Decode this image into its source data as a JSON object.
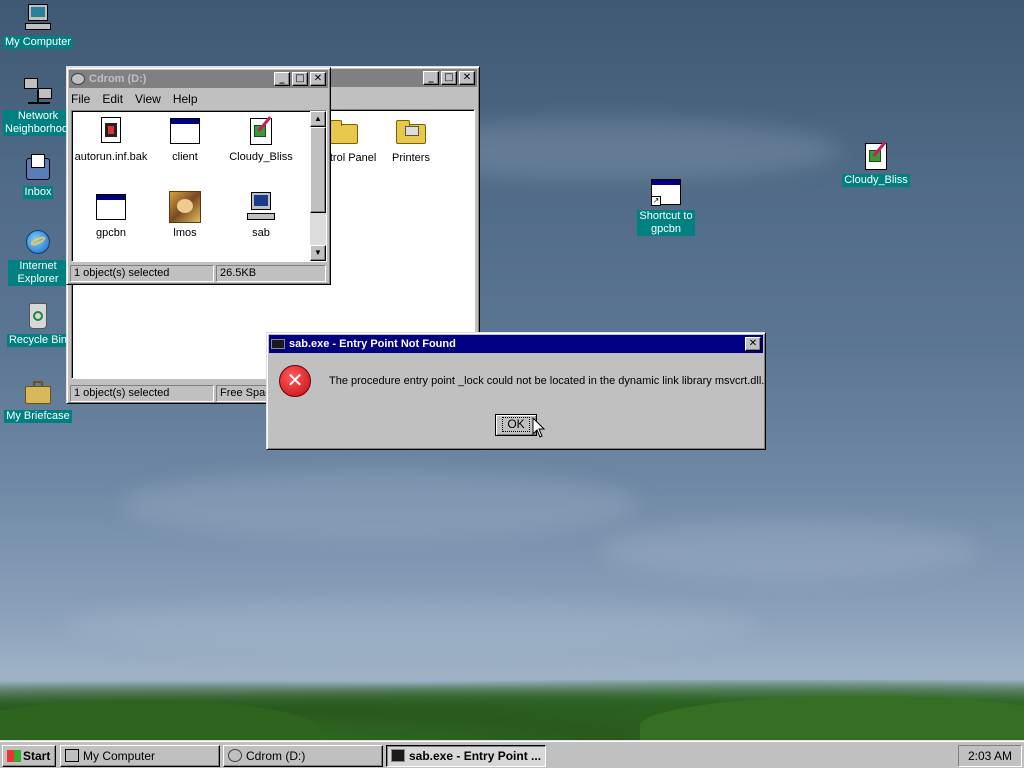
{
  "desktop": {
    "icons": [
      {
        "label": "My Computer",
        "icon": "my-computer-icon"
      },
      {
        "label": "Network Neighborhood",
        "icon": "network-neighborhood-icon"
      },
      {
        "label": "Inbox",
        "icon": "inbox-icon"
      },
      {
        "label": "Internet Explorer",
        "icon": "internet-explorer-icon"
      },
      {
        "label": "Recycle Bin",
        "icon": "recycle-bin-icon"
      },
      {
        "label": "My Briefcase",
        "icon": "briefcase-icon"
      },
      {
        "label": "Shortcut to gpcbn",
        "icon": "shortcut-app-icon"
      },
      {
        "label": "Cloudy_Bliss",
        "icon": "image-file-icon"
      }
    ]
  },
  "back_window": {
    "visible_items": [
      "Control Panel",
      "Printers"
    ],
    "status": {
      "selected": "1 object(s) selected",
      "free_space": "Free Space"
    }
  },
  "cdrom_window": {
    "title": "Cdrom (D:)",
    "menu": {
      "file": "File",
      "edit": "Edit",
      "view": "View",
      "help": "Help"
    },
    "files": [
      {
        "name": "autorun.inf.bak",
        "icon": "setup-file-icon"
      },
      {
        "name": "client",
        "icon": "app-window-icon"
      },
      {
        "name": "Cloudy_Bliss",
        "icon": "image-file-icon"
      },
      {
        "name": "gpcbn",
        "icon": "app-window-icon"
      },
      {
        "name": "lmos",
        "icon": "photo-icon"
      },
      {
        "name": "sab",
        "icon": "computer-program-icon"
      }
    ],
    "status": {
      "selected": "1 object(s) selected",
      "size": "26.5KB"
    }
  },
  "dialog": {
    "title": "sab.exe - Entry Point Not Found",
    "message": "The procedure entry point _lock could not be located in the dynamic link library msvcrt.dll.",
    "ok_label": "OK",
    "icon": "error-icon"
  },
  "taskbar": {
    "start_label": "Start",
    "tasks": [
      {
        "label": "My Computer"
      },
      {
        "label": "Cdrom (D:)"
      },
      {
        "label": "sab.exe - Entry Point ..."
      }
    ],
    "clock": "2:03 AM"
  },
  "colors": {
    "title_active": "#000080",
    "title_inactive": "#808080",
    "window_face": "#c0c0c0",
    "error_red": "#d4151b",
    "icon_label_bg": "#008080"
  }
}
